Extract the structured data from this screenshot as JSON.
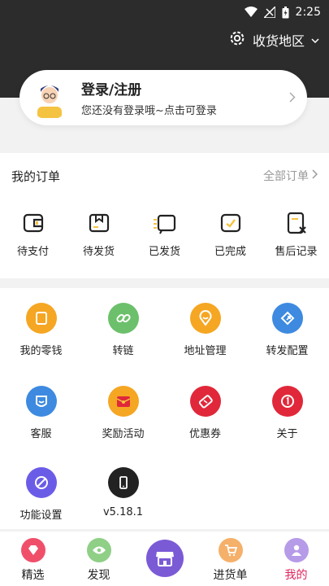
{
  "status_bar": {
    "time": "2:25"
  },
  "header": {
    "location_label": "收货地区"
  },
  "login": {
    "title": "登录/注册",
    "subtitle": "您还没有登录哦~点击可登录"
  },
  "orders": {
    "title": "我的订单",
    "all_label": "全部订单",
    "items": [
      {
        "label": "待支付",
        "icon": "wallet-icon"
      },
      {
        "label": "待发货",
        "icon": "package-icon"
      },
      {
        "label": "已发货",
        "icon": "truck-icon"
      },
      {
        "label": "已完成",
        "icon": "check-box-icon"
      },
      {
        "label": "售后记录",
        "icon": "return-doc-icon"
      }
    ]
  },
  "tools": [
    {
      "label": "我的零钱",
      "icon": "wallet-icon",
      "color": "#f5a623"
    },
    {
      "label": "转链",
      "icon": "link-icon",
      "color": "#6cc06b"
    },
    {
      "label": "地址管理",
      "icon": "location-pin-icon",
      "color": "#f5a623"
    },
    {
      "label": "转发配置",
      "icon": "share-icon",
      "color": "#3d8ae0"
    },
    {
      "label": "客服",
      "icon": "service-icon",
      "color": "#3d8ae0"
    },
    {
      "label": "奖励活动",
      "icon": "red-envelope-icon",
      "color": "#f5a623"
    },
    {
      "label": "优惠券",
      "icon": "ticket-icon",
      "color": "#e0283a"
    },
    {
      "label": "关于",
      "icon": "info-icon",
      "color": "#e0283a"
    },
    {
      "label": "功能设置",
      "icon": "settings-icon",
      "color": "#6b5ce7"
    },
    {
      "label": "v5.18.1",
      "icon": "phone-icon",
      "color": "#222222"
    }
  ],
  "tabbar": [
    {
      "label": "精选",
      "icon": "diamond-icon",
      "color": "#f04f6a"
    },
    {
      "label": "发现",
      "icon": "eye-icon",
      "color": "#8fcf86"
    },
    {
      "label": "",
      "icon": "store-icon",
      "color": "#7b5ad6"
    },
    {
      "label": "进货单",
      "icon": "cart-icon",
      "color": "#f5b06a"
    },
    {
      "label": "我的",
      "icon": "user-icon",
      "color": "#b69be8"
    }
  ]
}
